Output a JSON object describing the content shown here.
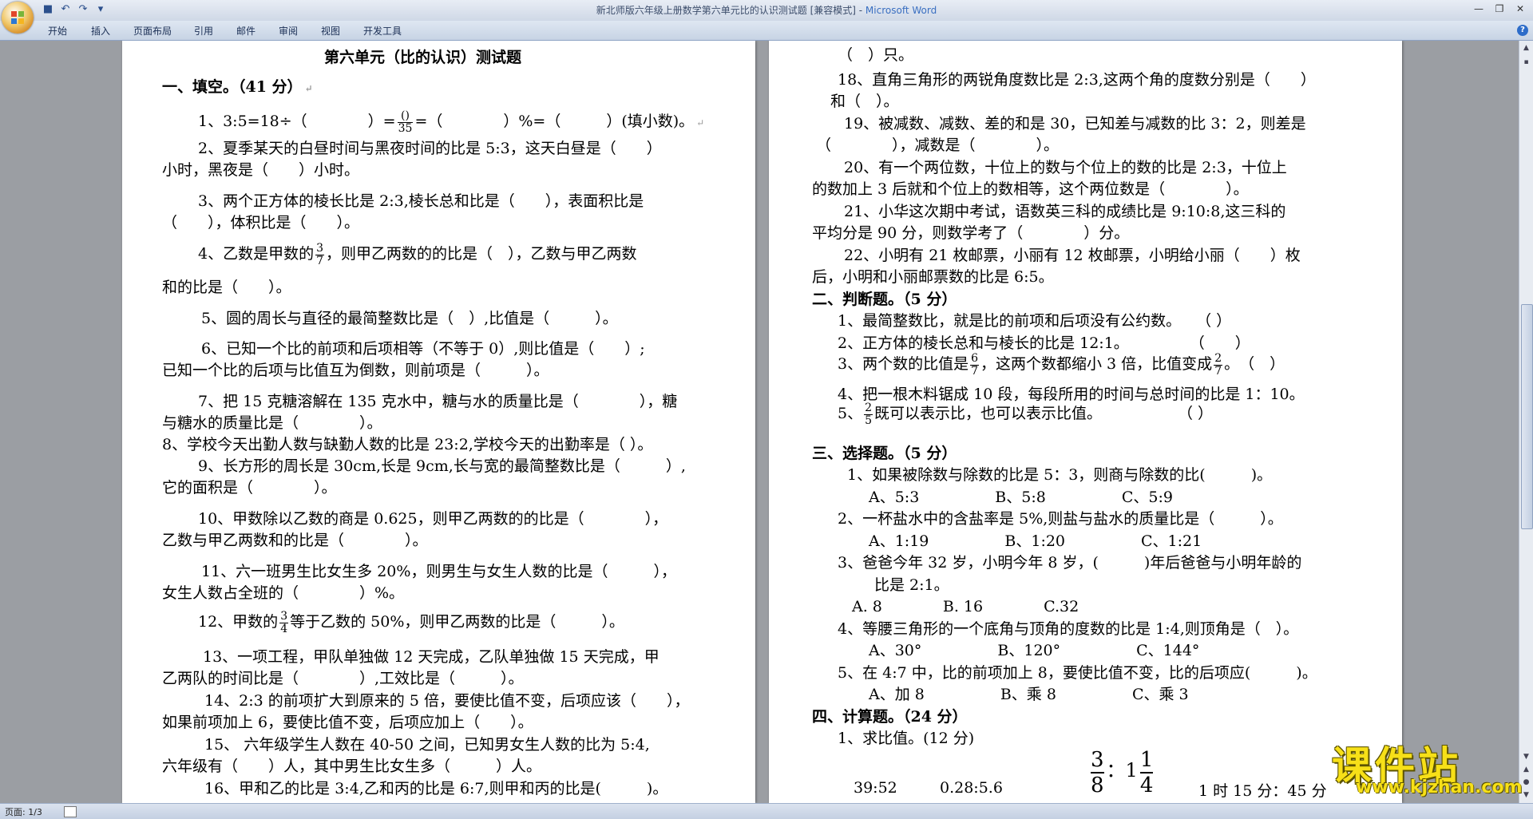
{
  "window": {
    "title": "新北师版六年级上册数学第六单元比的认识测试题 [兼容模式] - ",
    "app_name": "Microsoft Word"
  },
  "ribbon": {
    "tabs": [
      "开始",
      "插入",
      "页面布局",
      "引用",
      "邮件",
      "审阅",
      "视图",
      "开发工具"
    ]
  },
  "status": {
    "page": "页面: 1/3"
  },
  "watermark": {
    "cn": "课件站",
    "url": "www.kjzhan.com"
  },
  "page1": {
    "title": "第六单元（比的认识）测试题",
    "s1": "一、填空。（41 分）",
    "q1a": "1、3:5=18÷（　　　　）=",
    "q1_frac_num": "()",
    "q1_frac_den": "35",
    "q1b": "=（　　　　）%=（　　　）(填小数)。",
    "q2a": "2、夏季某天的白昼时间与黑夜时间的比是 5:3，这天白昼是（　　）",
    "q2b": "小时，黑夜是（　　）小时。",
    "q3a": "3、两个正方体的棱长比是 2:3,棱长总和比是（　　），表面积比是",
    "q3b": "（　　），体积比是（　　）。",
    "q4a": "4、乙数是甲数的",
    "q4_frac_num": "3",
    "q4_frac_den": "7",
    "q4b": "，则甲乙两数的的比是（　），乙数与甲乙两数",
    "q4c": "和的比是（　　）。",
    "q5": "5、圆的周长与直径的最简整数比是（　）,比值是（　　　）。",
    "q6a": "6、已知一个比的前项和后项相等（不等于 0）,则比值是（　　）;",
    "q6b": "已知一个比的后项与比值互为倒数，则前项是（　　　）。",
    "q7a": "7、把 15 克糖溶解在 135 克水中，糖与水的质量比是（　　　　），糖",
    "q7b": "与糖水的质量比是（　　　　）。",
    "q8": "8、学校今天出勤人数与缺勤人数的比是 23:2,学校今天的出勤率是（ ）。",
    "q9a": "9、长方形的周长是 30cm,长是 9cm,长与宽的最简整数比是（　　　）,",
    "q9b": "它的面积是（　　　　）。",
    "q10a": "10、甲数除以乙数的商是 0.625，则甲乙两数的的比是（　　　　），",
    "q10b": "乙数与甲乙两数和的比是（　　　　）。",
    "q11a": "11、六一班男生比女生多 20%，则男生与女生人数的比是（　　　），",
    "q11b": "女生人数占全班的（　　　　）%。",
    "q12a": "12、甲数的",
    "q12_frac_num": "3",
    "q12_frac_den": "4",
    "q12b": "等于乙数的 50%，则甲乙两数的比是（　　　）。",
    "q13a": "13、一项工程，甲队单独做 12 天完成，乙队单独做 15 天完成，甲",
    "q13b": "乙两队的时间比是（　　　　）,工效比是（　　　）。",
    "q14a": "14、2:3 的前项扩大到原来的 5 倍，要使比值不变，后项应该（　　），",
    "q14b": "如果前项加上 6，要使比值不变，后项应加上（　　）。",
    "q15a": "15、 六年级学生人数在 40-50 之间，已知男女生人数的比为 5:4,",
    "q15b": "六年级有（　　）人，其中男生比女生多（　　　）人。",
    "q16": "16、甲和乙的比是 3:4,乙和丙的比是 6:7,则甲和丙的比是(　　　)。"
  },
  "page2": {
    "l0": "（　）只。",
    "q18a": "18、直角三角形的两锐角度数比是 2:3,这两个角的度数分别是（　　）",
    "q18b": "和（　）。",
    "q19a": "19、被减数、减数、差的和是 30，已知差与减数的比 3：2，则差是",
    "q19b": "（　　　　），减数是（　　　　）。",
    "q20a": "20、有一个两位数，十位上的数与个位上的数的比是 2:3，十位上",
    "q20b": "的数加上 3 后就和个位上的数相等，这个两位数是（　　　　）。",
    "q21a": "21、小华这次期中考试，语数英三科的成绩比是 9:10:8,这三科的",
    "q21b": "平均分是 90 分，则数学考了（　　　　）分。",
    "q22a": "22、小明有 21 枚邮票，小丽有 12 枚邮票，小明给小丽（　　）枚",
    "q22b": "后，小明和小丽邮票数的比是 6:5。",
    "s2": "二、判断题。（5 分）",
    "j1": "1、最简整数比，就是比的前项和后项没有公约数。　　（ ）",
    "j2": "2、正方体的棱长总和与棱长的比是 12:1。　　　　　（　　）",
    "j3a": "3、两个数的比值是",
    "j3_f1_num": "6",
    "j3_f1_den": "7",
    "j3b": "，这两个数都缩小 3 倍，比值变成",
    "j3_f2_num": "2",
    "j3_f2_den": "7",
    "j3c": "。　（　）",
    "j4": "4、把一根木料锯成 10 段，每段所用的时间与总时间的比是 1：10。",
    "j5a": "5、",
    "j5_frac_num": "2",
    "j5_frac_den": "5",
    "j5b": "既可以表示比，也可以表示比值。　　　　　　（ ）",
    "s3": "三、选择题。（5 分）",
    "c1": "1、如果被除数与除数的比是 5：3，则商与除数的比(　　　)。",
    "c1o": "A、5:3　　　　　B、5:8　　　　　C、5:9",
    "c2": "2、一杯盐水中的含盐率是 5%,则盐与盐水的质量比是（　　　）。",
    "c2o": "A、1:19　　　　　B、1:20　　　　　C、1:21",
    "c3a": "3、爸爸今年 32 岁，小明今年 8 岁，(　　　)年后爸爸与小明年龄的",
    "c3b": "比是 2:1。",
    "c3o": "A. 8　　　　B. 16　　　　C.32",
    "c4": "4、等腰三角形的一个底角与顶角的度数的比是 1:4,则顶角是（　）。",
    "c4o": "A、30°　　　　　B、120°　　　　　C、144°",
    "c5": "5、在 4:7 中，比的前项加上 8，要使比值不变，比的后项应(　　　)。",
    "c5o": "A、加 8　　　　　B、乘 8　　　　　C、乘 3",
    "s4": "四、计算题。（24 分）",
    "k1": "1、求比值。(12 分)",
    "e1": "39:52",
    "e2": "0.28:5.6",
    "e3_n1": "3",
    "e3_d1": "8",
    "e3_sep": "：1",
    "e3_n2": "1",
    "e3_d2": "4",
    "e4": "1 时 15 分：45 分"
  }
}
